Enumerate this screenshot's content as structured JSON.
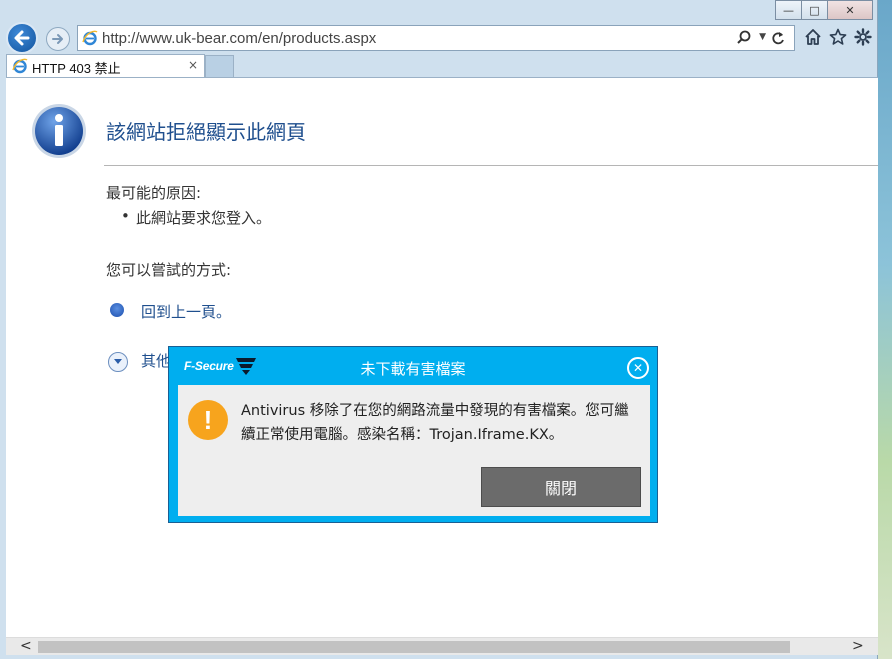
{
  "browser": {
    "address_url": "http://www.uk-bear.com/en/products.aspx",
    "tab_title": "HTTP 403 禁止",
    "tab_close": "×",
    "caption": {
      "minimize": "—",
      "maximize": "□",
      "close": "✕"
    }
  },
  "page": {
    "title": "該網站拒絕顯示此網頁",
    "reason_heading": "最可能的原因:",
    "reason_bullet": "•",
    "reason_item": "此網站要求您登入。",
    "try_heading": "您可以嘗試的方式:",
    "back_link": "回到上一頁。",
    "more_link": "其他"
  },
  "dialog": {
    "brand": "F-Secure",
    "title": "未下載有害檔案",
    "close_glyph": "✕",
    "warning_glyph": "!",
    "message": "Antivirus 移除了在您的網路流量中發現的有害檔案。您可繼續正常使用電腦。感染名稱：Trojan.Iframe.KX。",
    "close_button": "關閉"
  },
  "scrollbar": {
    "left_arrow": "<",
    "right_arrow": ">"
  },
  "colors": {
    "dialog_blue": "#00aeef",
    "warning_orange": "#f7a41d",
    "link_blue": "#1f4f8e",
    "close_button_gray": "#6b6b6b"
  },
  "icons": [
    "back-arrow-icon",
    "forward-arrow-icon",
    "ie-logo-icon",
    "search-icon",
    "refresh-icon",
    "home-icon",
    "favorites-star-icon",
    "settings-gear-icon",
    "info-icon",
    "warning-icon",
    "fsecure-logo-icon",
    "close-circle-icon"
  ]
}
